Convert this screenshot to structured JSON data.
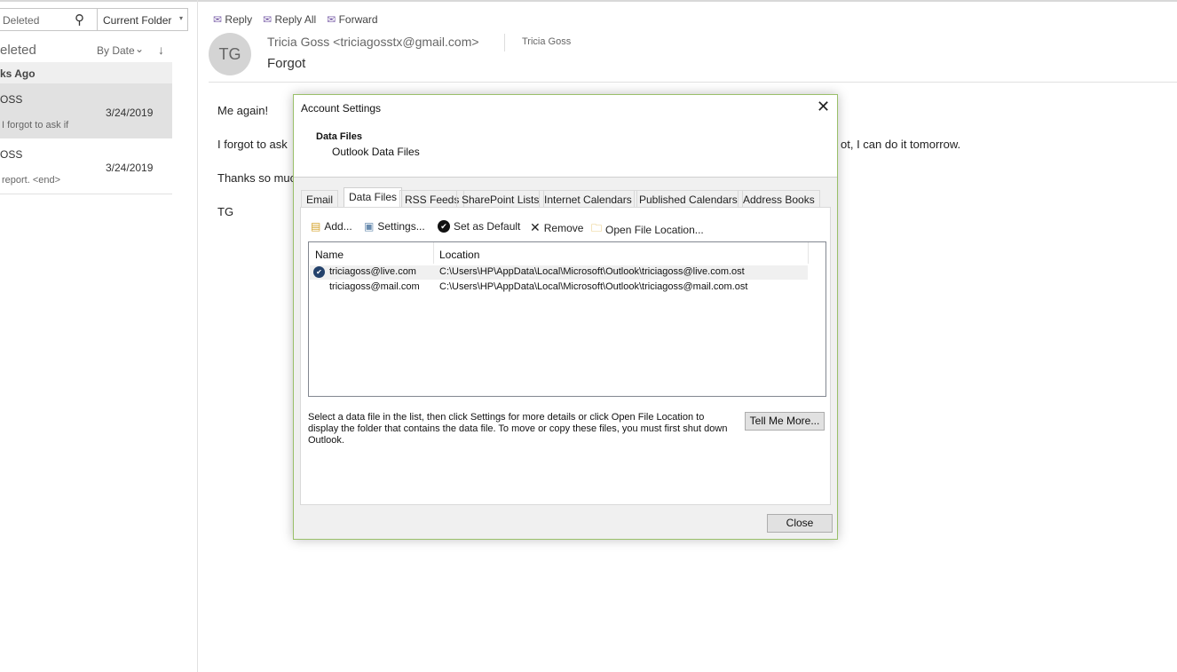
{
  "search": {
    "value": "Deleted",
    "scope": "Current Folder"
  },
  "folder": {
    "title": "eleted",
    "sort": "By Date"
  },
  "group": "ks Ago",
  "messages": [
    {
      "sender": "OSS",
      "date": "3/24/2019",
      "preview": "I forgot to ask if"
    },
    {
      "sender": "OSS",
      "date": "3/24/2019",
      "preview": "report. <end>"
    }
  ],
  "toolbar": {
    "reply": "Reply",
    "reply_all": "Reply All",
    "forward": "Forward"
  },
  "email": {
    "initials": "TG",
    "from": "Tricia Goss <triciagosstx@gmail.com>",
    "to": "Tricia Goss",
    "subject": "Forgot",
    "body": [
      "Me again!",
      "I forgot to ask",
      "ot, I can do it tomorrow.",
      "Thanks so muc",
      "TG"
    ]
  },
  "dialog": {
    "title": "Account Settings",
    "heading": "Data Files",
    "subheading": "Outlook Data Files",
    "tabs": [
      "Email",
      "Data Files",
      "RSS Feeds",
      "SharePoint Lists",
      "Internet Calendars",
      "Published Calendars",
      "Address Books"
    ],
    "actions": {
      "add": "Add...",
      "settings": "Settings...",
      "default": "Set as Default",
      "remove": "Remove",
      "open": "Open File Location..."
    },
    "columns": [
      "Name",
      "Location"
    ],
    "rows": [
      {
        "name": "triciagoss@live.com",
        "location": "C:\\Users\\HP\\AppData\\Local\\Microsoft\\Outlook\\triciagoss@live.com.ost",
        "default": true
      },
      {
        "name": "triciagoss@mail.com",
        "location": "C:\\Users\\HP\\AppData\\Local\\Microsoft\\Outlook\\triciagoss@mail.com.ost",
        "default": false
      }
    ],
    "help": "Select a data file in the list, then click Settings for more details or click Open File Location to display the folder that contains the data file. To move or copy these files, you must first shut down Outlook.",
    "tell_more": "Tell Me More...",
    "close": "Close"
  }
}
